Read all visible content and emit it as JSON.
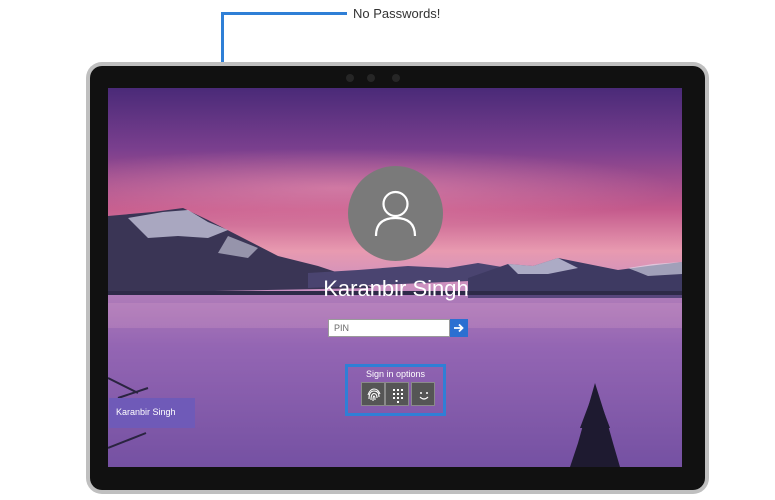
{
  "annotation": {
    "callout_label": "No Passwords!"
  },
  "lock_screen": {
    "user_name": "Karanbir Singh",
    "pin_placeholder": "PIN",
    "sign_in_options_label": "Sign in options",
    "sign_in_options": [
      {
        "icon": "fingerprint-icon"
      },
      {
        "icon": "pin-keypad-icon"
      },
      {
        "icon": "face-icon"
      }
    ],
    "user_list": [
      {
        "name": "Karanbir Singh"
      }
    ]
  },
  "colors": {
    "accent_blue": "#2b6fd1",
    "annotation_blue": "#2f7fd6",
    "user_tile": "#6f5ab8"
  }
}
